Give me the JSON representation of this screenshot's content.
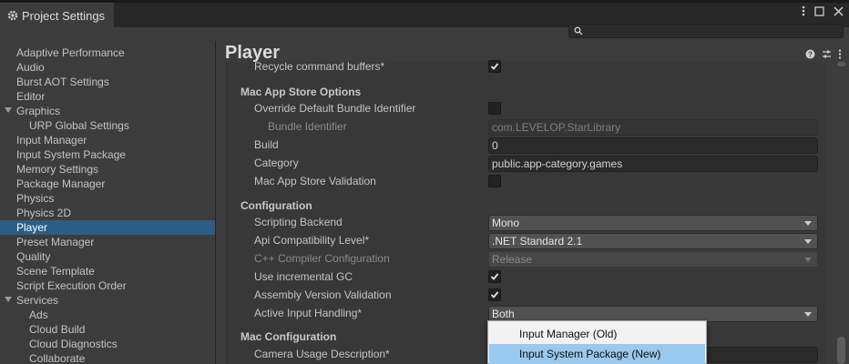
{
  "window": {
    "tab_title": "Project Settings",
    "icons": [
      "gear-icon",
      "kebab-menu-icon",
      "maximize-icon",
      "close-icon"
    ],
    "search": {
      "value": "",
      "placeholder": ""
    }
  },
  "sidebar": {
    "items": [
      {
        "label": "Adaptive Performance",
        "indent": 0
      },
      {
        "label": "Audio",
        "indent": 0
      },
      {
        "label": "Burst AOT Settings",
        "indent": 0
      },
      {
        "label": "Editor",
        "indent": 0
      },
      {
        "label": "Graphics",
        "indent": 0,
        "expanded": true
      },
      {
        "label": "URP Global Settings",
        "indent": 1
      },
      {
        "label": "Input Manager",
        "indent": 0
      },
      {
        "label": "Input System Package",
        "indent": 0
      },
      {
        "label": "Memory Settings",
        "indent": 0
      },
      {
        "label": "Package Manager",
        "indent": 0
      },
      {
        "label": "Physics",
        "indent": 0
      },
      {
        "label": "Physics 2D",
        "indent": 0
      },
      {
        "label": "Player",
        "indent": 0,
        "selected": true
      },
      {
        "label": "Preset Manager",
        "indent": 0
      },
      {
        "label": "Quality",
        "indent": 0
      },
      {
        "label": "Scene Template",
        "indent": 0
      },
      {
        "label": "Script Execution Order",
        "indent": 0
      },
      {
        "label": "Services",
        "indent": 0,
        "expanded": true
      },
      {
        "label": "Ads",
        "indent": 1
      },
      {
        "label": "Cloud Build",
        "indent": 1
      },
      {
        "label": "Cloud Diagnostics",
        "indent": 1
      },
      {
        "label": "Collaborate",
        "indent": 1
      }
    ]
  },
  "content": {
    "title": "Player",
    "header_icons": [
      "help-icon",
      "presets-icon",
      "kebab-menu-icon"
    ],
    "rows": {
      "recycle": {
        "label": "Recycle command buffers*",
        "checked": true
      },
      "mac_store_header": "Mac App Store Options",
      "override_bundle": {
        "label": "Override Default Bundle Identifier",
        "checked": false
      },
      "bundle_id": {
        "label": "Bundle Identifier",
        "value": "com.LEVELOP.StarLibrary"
      },
      "build": {
        "label": "Build",
        "value": "0"
      },
      "category": {
        "label": "Category",
        "value": "public.app-category.games"
      },
      "store_validation": {
        "label": "Mac App Store Validation",
        "checked": false
      },
      "config_header": "Configuration",
      "scripting_backend": {
        "label": "Scripting Backend",
        "value": "Mono"
      },
      "api_level": {
        "label": "Api Compatibility Level*",
        "value": ".NET Standard 2.1"
      },
      "cpp_compiler": {
        "label": "C++ Compiler Configuration",
        "value": "Release"
      },
      "incremental_gc": {
        "label": "Use incremental GC",
        "checked": true
      },
      "assembly_validation": {
        "label": "Assembly Version Validation",
        "checked": true
      },
      "input_handling": {
        "label": "Active Input Handling*",
        "value": "Both"
      },
      "mac_config_header": "Mac Configuration",
      "camera_usage": {
        "label": "Camera Usage Description*",
        "value": ""
      }
    },
    "popup": {
      "options": [
        "Input Manager (Old)",
        "Input System Package (New)"
      ],
      "highlighted": "Input System Package (New)"
    }
  },
  "colors": {
    "selection": "#2c5d87",
    "popup_highlight": "#99c9ef",
    "panel": "#3c3c3c"
  }
}
